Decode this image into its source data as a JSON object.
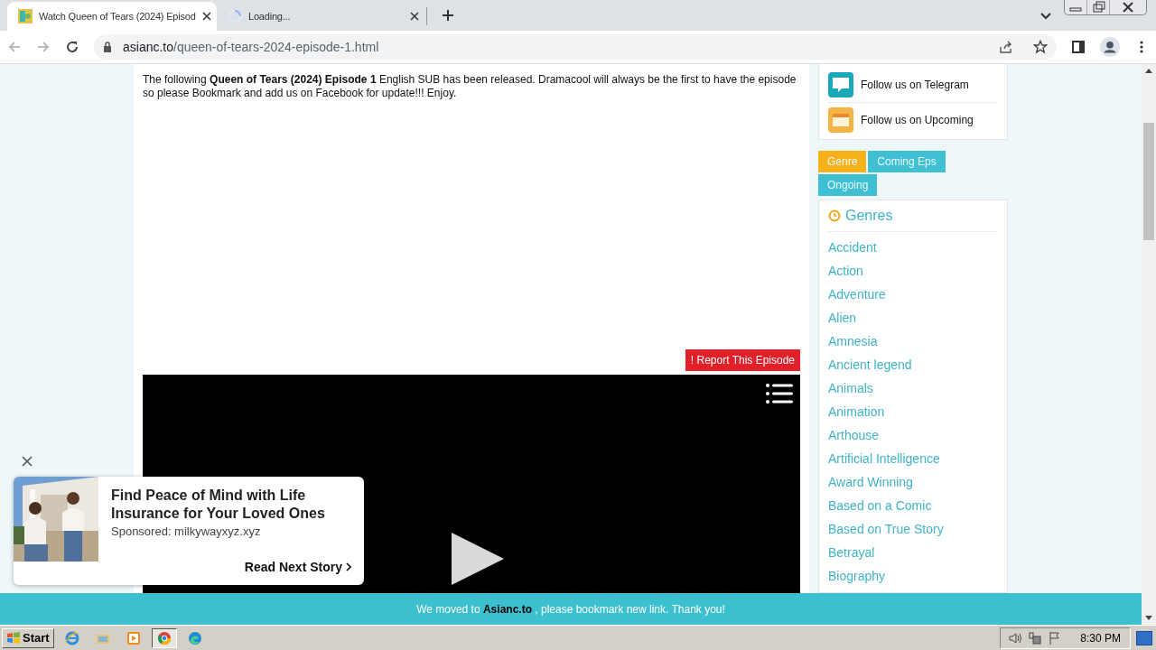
{
  "browser": {
    "tabs": [
      {
        "title": "Watch Queen of Tears (2024) Episod",
        "selected": true,
        "loading": false
      },
      {
        "title": "Loading...",
        "selected": false,
        "loading": true
      }
    ],
    "url": {
      "host": "asianc.to",
      "path": "/queen-of-tears-2024-episode-1.html"
    }
  },
  "article": {
    "intro": "The following **Queen of Tears (2024) Episode 1** English SUB has been released. Dramacool will always be the first to have the episode so please Bookmark and add us on Facebook for update!!! Enjoy.",
    "report_button": "! Report This Episode"
  },
  "sidebar": {
    "follow_links": [
      {
        "label": "Follow us on Telegram",
        "kind": "telegram"
      },
      {
        "label": "Follow us on Upcoming",
        "kind": "upcoming"
      }
    ],
    "tabs": [
      {
        "label": "Genre",
        "selected": true
      },
      {
        "label": "Coming Eps",
        "selected": false
      },
      {
        "label": "Ongoing",
        "selected": false
      }
    ],
    "genres_title": "Genres",
    "genres": [
      "Accident",
      "Action",
      "Adventure",
      "Alien",
      "Amnesia",
      "Ancient legend",
      "Animals",
      "Animation",
      "Arthouse",
      "Artificial Intelligence",
      "Award Winning",
      "Based on a Comic",
      "Based on True Story",
      "Betrayal",
      "Biography"
    ]
  },
  "banner": {
    "before": "We moved to ",
    "link": "Asianc.to",
    "after": " , please bookmark new link. Thank you!"
  },
  "ad": {
    "kind": "picture",
    "headline": "Find Peace of Mind with Life Insurance for Your Loved Ones",
    "sponsor": "Sponsored: milkywayxyz.xyz",
    "cta": "Read Next Story"
  },
  "taskbar": {
    "start": "Start",
    "apps": [
      {
        "kind": "ie",
        "selected": false
      },
      {
        "kind": "explorer",
        "selected": false
      },
      {
        "kind": "media",
        "selected": false
      },
      {
        "kind": "chrome",
        "selected": true
      },
      {
        "kind": "edge",
        "selected": false
      }
    ],
    "clock": "8:30 PM"
  }
}
